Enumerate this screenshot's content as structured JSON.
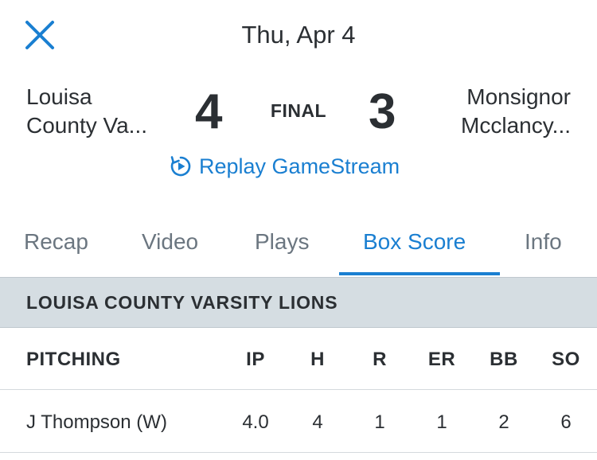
{
  "header": {
    "date": "Thu, Apr 4",
    "close_icon": "close-icon"
  },
  "game": {
    "home_team": {
      "line1": "Louisa",
      "line2": "County Va..."
    },
    "away_team": {
      "line1": "Monsignor",
      "line2": "Mcclancy..."
    },
    "home_score": "4",
    "away_score": "3",
    "status": "FINAL",
    "replay_label": "Replay GameStream",
    "replay_icon": "replay-icon"
  },
  "tabs": [
    {
      "label": "Recap",
      "active": false
    },
    {
      "label": "Video",
      "active": false
    },
    {
      "label": "Plays",
      "active": false
    },
    {
      "label": "Box Score",
      "active": true
    },
    {
      "label": "Info",
      "active": false
    }
  ],
  "box_score": {
    "team_header": "LOUISA COUNTY VARSITY LIONS",
    "columns": [
      "PITCHING",
      "IP",
      "H",
      "R",
      "ER",
      "BB",
      "SO"
    ],
    "rows": [
      [
        "J Thompson (W)",
        "4.0",
        "4",
        "1",
        "1",
        "2",
        "6"
      ]
    ]
  },
  "colors": {
    "accent": "#1a7fd1",
    "text": "#2b2f33",
    "muted": "#6b7680",
    "section_bg": "#d5dde2"
  }
}
